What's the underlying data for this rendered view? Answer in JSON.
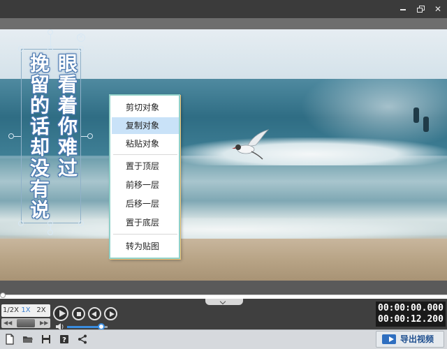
{
  "window": {
    "controls": [
      "minimize-icon",
      "maximize-icon",
      "close-icon"
    ],
    "close_glyph": "✕"
  },
  "sticker": {
    "lines": [
      "眼看着你难过",
      "挽留的话却没有说"
    ],
    "close_glyph": "×",
    "colors": {
      "text": "#ffffff",
      "outline": "#4a78b0"
    }
  },
  "context_menu": {
    "items": [
      {
        "label": "剪切对象",
        "hover": false
      },
      {
        "label": "复制对象",
        "hover": true
      },
      {
        "label": "粘贴对象",
        "hover": false
      },
      {
        "label": "置于顶层",
        "hover": false
      },
      {
        "label": "前移一层",
        "hover": false
      },
      {
        "label": "后移一层",
        "hover": false
      },
      {
        "label": "置于底层",
        "hover": false
      },
      {
        "label": "转为贴图",
        "hover": false
      }
    ],
    "colors": {
      "hover": "#c9e2f8",
      "border": "#8fd0c8"
    }
  },
  "playback": {
    "speeds": [
      "1/2X",
      "1X",
      "2X"
    ],
    "active_speed": "1X",
    "rewind_left": "◀◀",
    "rewind_right": "▶▶",
    "buttons": [
      "play-icon",
      "stop-icon",
      "previous-icon",
      "next-icon"
    ],
    "volume": 0.85,
    "progress": 0.0,
    "current_time": "00:00:00.000",
    "total_time": "00:00:12.200"
  },
  "toolbar": {
    "tools": [
      "new-file-icon",
      "open-folder-icon",
      "save-icon",
      "help-icon",
      "share-icon"
    ],
    "export_label": "导出视频",
    "export_color": "#2f6fc0"
  }
}
